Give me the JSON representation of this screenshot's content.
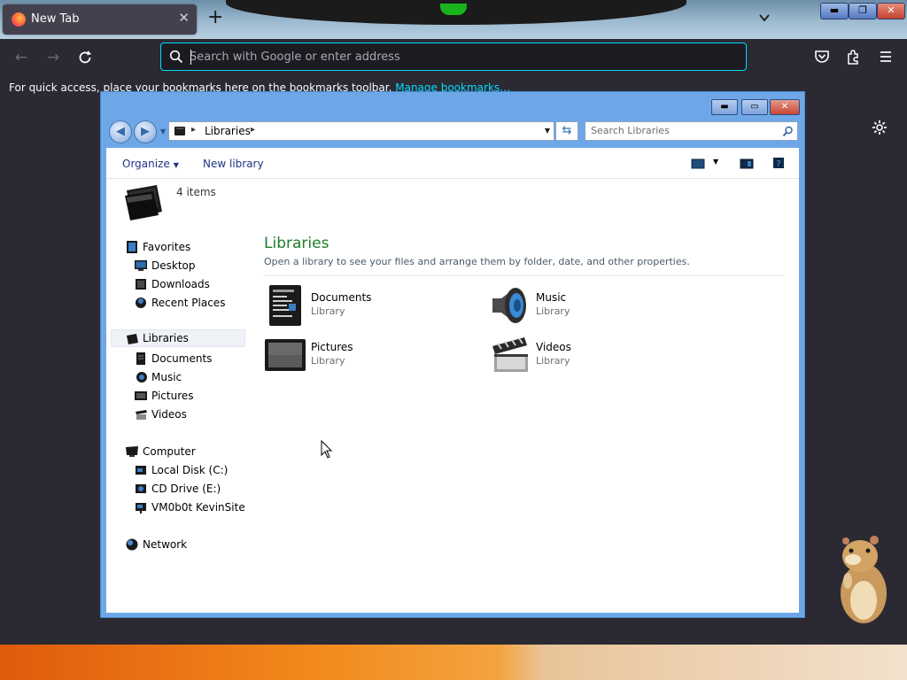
{
  "browser": {
    "tab_title": "New Tab",
    "url_placeholder": "Search with Google or enter address",
    "bookmarks_text": "For quick access, place your bookmarks here on the bookmarks toolbar.",
    "bookmarks_link": "Manage bookmarks…",
    "accent": "#00ddff"
  },
  "explorer": {
    "breadcrumb": "Libraries",
    "search_placeholder": "Search Libraries",
    "commands": {
      "organize": "Organize",
      "new_library": "New library"
    },
    "details_count": "4 items",
    "nav": {
      "favorites": "Favorites",
      "favorites_items": [
        "Desktop",
        "Downloads",
        "Recent Places"
      ],
      "libraries": "Libraries",
      "libraries_items": [
        "Documents",
        "Music",
        "Pictures",
        "Videos"
      ],
      "computer": "Computer",
      "computer_items": [
        "Local Disk (C:)",
        "CD Drive (E:)",
        "VM0b0t KevinSite"
      ],
      "network": "Network"
    },
    "main": {
      "title": "Libraries",
      "subtitle": "Open a library to see your files and arrange them by folder, date, and other properties.",
      "libraries": [
        {
          "name": "Documents",
          "type": "Library",
          "icon": "documents-library-icon"
        },
        {
          "name": "Music",
          "type": "Library",
          "icon": "music-library-icon"
        },
        {
          "name": "Pictures",
          "type": "Library",
          "icon": "pictures-library-icon"
        },
        {
          "name": "Videos",
          "type": "Library",
          "icon": "videos-library-icon"
        }
      ]
    },
    "title_color": "#1e7d2a",
    "frame_color": "#6ea7e8"
  }
}
